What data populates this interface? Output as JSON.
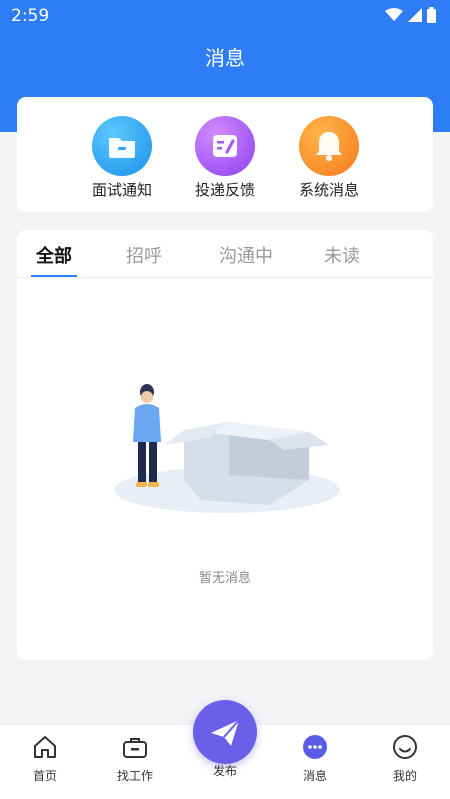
{
  "status_bar": {
    "time": "2:59"
  },
  "header": {
    "title": "消息"
  },
  "categories": [
    {
      "label": "面试通知",
      "icon": "folder-icon",
      "color": "#2aa4f2"
    },
    {
      "label": "投递反馈",
      "icon": "edit-icon",
      "color": "#a15af2"
    },
    {
      "label": "系统消息",
      "icon": "bell-icon",
      "color": "#fb8a2a"
    }
  ],
  "tabs": [
    {
      "label": "全部",
      "active": true
    },
    {
      "label": "招呼",
      "active": false
    },
    {
      "label": "沟通中",
      "active": false
    },
    {
      "label": "未读",
      "active": false
    }
  ],
  "empty": {
    "text": "暂无消息"
  },
  "bottom_nav": {
    "items": [
      {
        "label": "首页",
        "icon": "home-icon"
      },
      {
        "label": "找工作",
        "icon": "briefcase-icon"
      },
      {
        "label": "发布",
        "icon": "send-icon"
      },
      {
        "label": "消息",
        "icon": "chat-icon",
        "active": true
      },
      {
        "label": "我的",
        "icon": "smile-icon"
      }
    ]
  },
  "colors": {
    "brand": "#2f7df6",
    "publish": "#6a5fe6"
  }
}
